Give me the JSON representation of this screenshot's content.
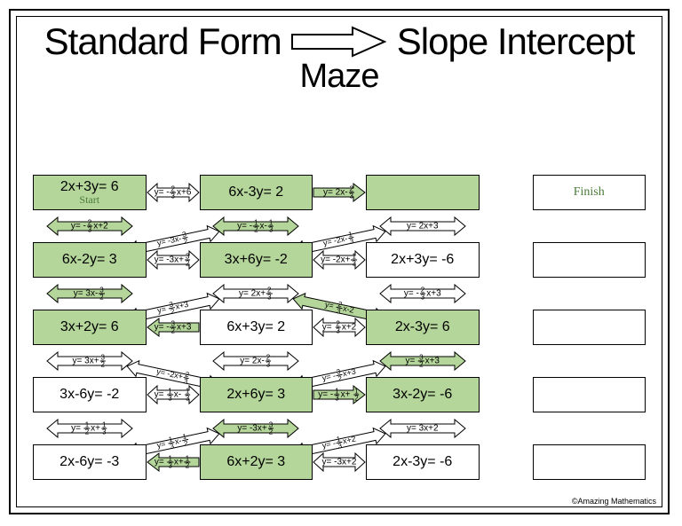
{
  "title_left": "Standard Form",
  "title_right": "Slope Intercept",
  "subtitle": "Maze",
  "credit": "©Amazing Mathematics",
  "start_label": "Start",
  "finish_label": "Finish",
  "boxes": [
    [
      "2x+3y= 6",
      "6x-3y= 2",
      ""
    ],
    [
      "6x-2y= 3",
      "3x+6y= -2",
      "2x+3y= -6",
      ""
    ],
    [
      "3x+2y= 6",
      "6x+3y= 2",
      "2x-3y= 6",
      ""
    ],
    [
      "3x-6y= -2",
      "2x+6y= 3",
      "3x-2y= -6",
      ""
    ],
    [
      "2x-6y= -3",
      "6x+2y= 3",
      "2x-3y= -6",
      ""
    ]
  ],
  "box_green": [
    [
      true,
      true,
      true,
      null
    ],
    [
      true,
      true,
      false,
      null
    ],
    [
      true,
      false,
      true,
      null
    ],
    [
      false,
      true,
      true,
      null
    ],
    [
      false,
      true,
      false,
      null
    ]
  ],
  "h_arrows": [
    [
      {
        "label_html": "y= -{2/3}x+6",
        "green": false,
        "dir": "both"
      },
      {
        "label_html": "y= 2x-{2/3}",
        "green": true,
        "dir": "right"
      },
      {
        "label_html": "",
        "green": false,
        "dir": "none"
      }
    ],
    [
      {
        "label_html": "y= -3x+{3/2}",
        "green": false,
        "dir": "both"
      },
      {
        "label_html": "y= -2x+{1/3}",
        "green": false,
        "dir": "both"
      },
      {
        "label_html": "",
        "green": false,
        "dir": "none"
      }
    ],
    [
      {
        "label_html": "y= -{3/2}x+3",
        "green": true,
        "dir": "left"
      },
      {
        "label_html": "y= {2/3}x+2",
        "green": false,
        "dir": "both"
      },
      {
        "label_html": "",
        "green": false,
        "dir": "none"
      }
    ],
    [
      {
        "label_html": "y= {1/3}x- {1/3}",
        "green": false,
        "dir": "both"
      },
      {
        "label_html": "y= -{1/3}x+ {1/2}",
        "green": true,
        "dir": "right"
      },
      {
        "label_html": "",
        "green": false,
        "dir": "none"
      }
    ],
    [
      {
        "label_html": "y= {1/3}x+{1/2}",
        "green": true,
        "dir": "left"
      },
      {
        "label_html": "y= -3x+2",
        "green": false,
        "dir": "both"
      },
      {
        "label_html": "",
        "green": false,
        "dir": "none"
      }
    ]
  ],
  "v_arrows": [
    [
      {
        "label_html": "y= -{2/3}x+2",
        "green": true
      },
      {
        "label_html": "y= -{1/2}x-{1/3}",
        "green": true
      },
      {
        "label_html": "y= 2x+3",
        "green": false
      }
    ],
    [
      {
        "label_html": "y= 3x-{3/2}",
        "green": true
      },
      {
        "label_html": "y= 2x+{2/3}",
        "green": false
      },
      {
        "label_html": "y= -{2/3}x+3",
        "green": false
      }
    ],
    [
      {
        "label_html": "y= 3x+{3/2}",
        "green": false
      },
      {
        "label_html": "y= 2x-{2/3}",
        "green": false
      },
      {
        "label_html": "y= {3/2}x+3",
        "green": true
      }
    ],
    [
      {
        "label_html": "y= {1/2}x+{1/3}",
        "green": false
      },
      {
        "label_html": "y= -3x+{3/2}",
        "green": true
      },
      {
        "label_html": "y= 3x+2",
        "green": false
      }
    ]
  ],
  "diag_arrows": [
    [
      {
        "label_html": "y= -3x-{3/2}",
        "slant": "up"
      },
      {
        "label_html": "y= -2x-{1/3}",
        "slant": "up"
      }
    ],
    [
      {
        "label_html": "y= {3/2}x+3",
        "slant": "up"
      },
      {
        "label_html": "y= {2/3}x-2",
        "slant": "down",
        "green": true
      }
    ],
    [
      {
        "label_html": "y= -2x+{2/3}",
        "slant": "down"
      },
      {
        "label_html": "y= -{3/2}x+3",
        "slant": "up"
      }
    ],
    [
      {
        "label_html": "y= {1/3}x-{1/2}",
        "slant": "up"
      },
      {
        "label_html": "y= -{1/3}x+2",
        "slant": "up"
      }
    ]
  ]
}
